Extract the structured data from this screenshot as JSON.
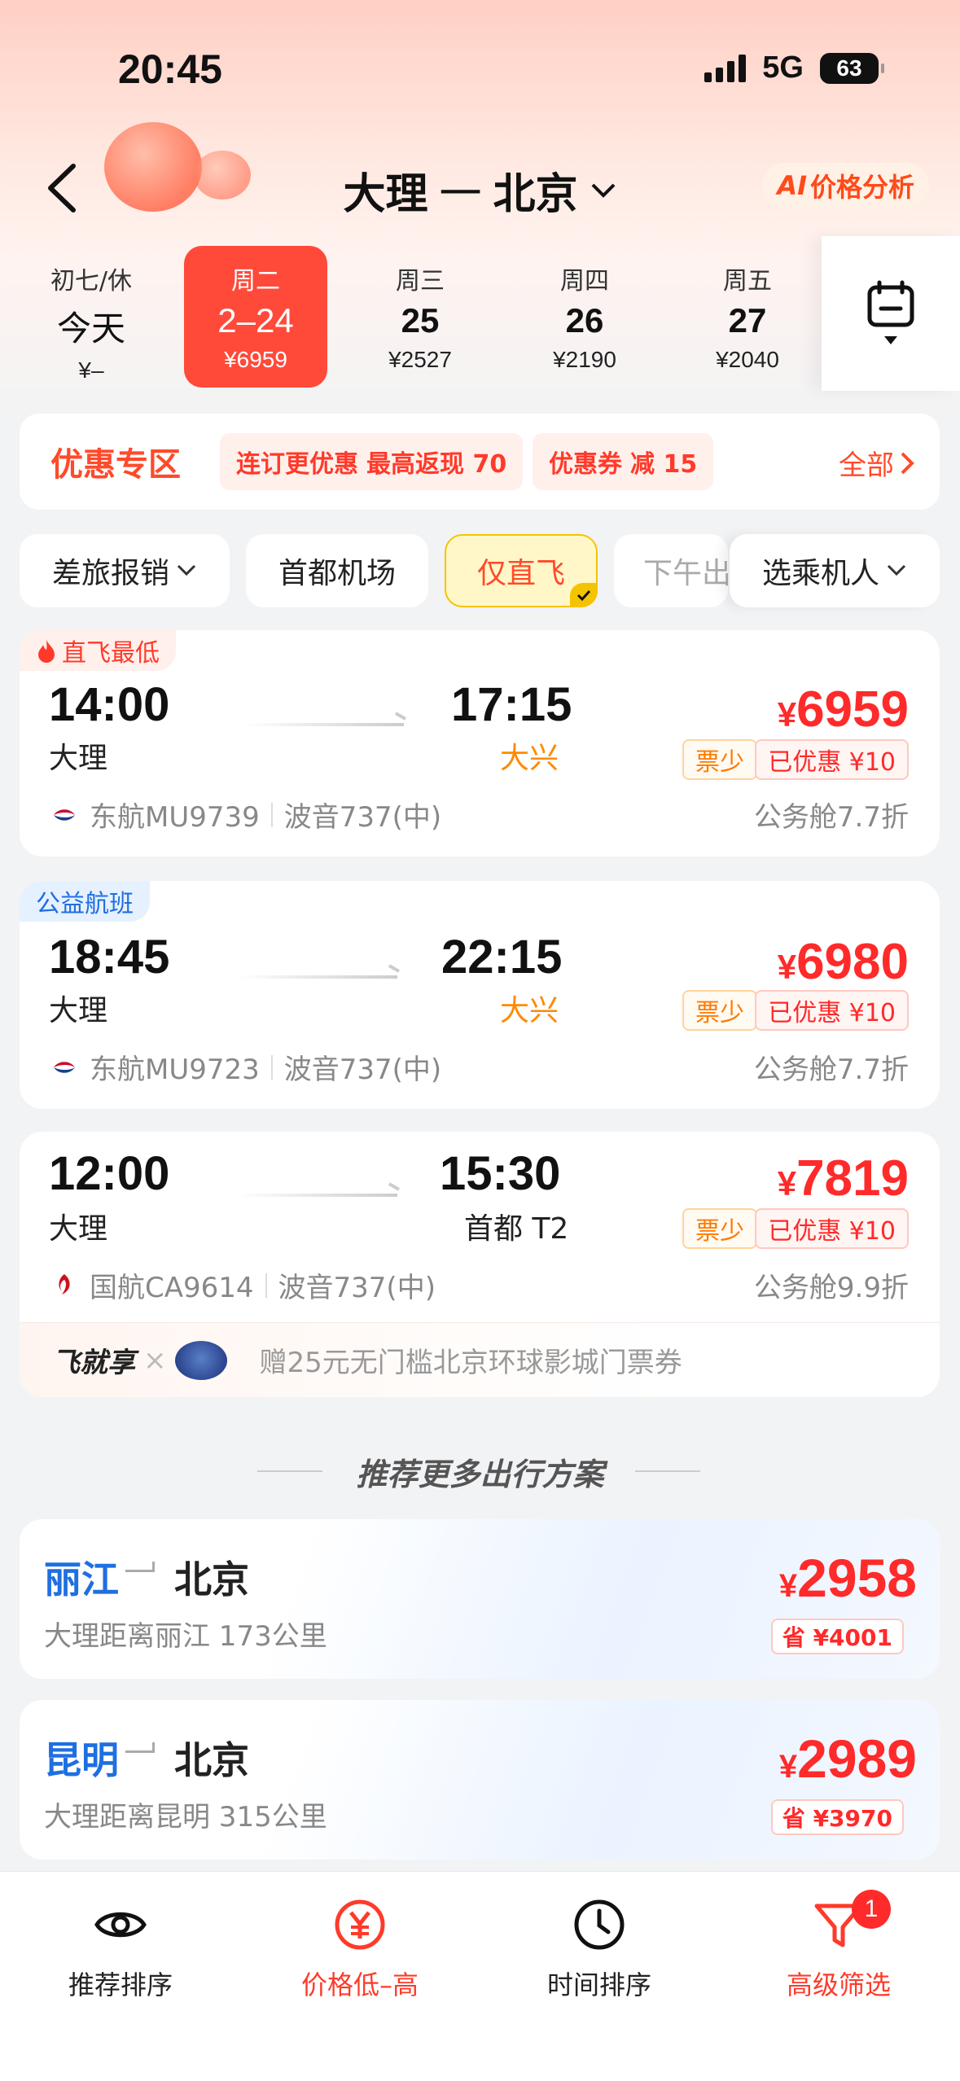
{
  "status_bar": {
    "time": "20:45",
    "network": "5G",
    "battery": "63"
  },
  "header": {
    "from": "大理",
    "separator": "一",
    "to": "北京",
    "ai_button": "价格分析",
    "ai_prefix": "AI"
  },
  "dates": [
    {
      "weekday": "初七/休",
      "date": "今天",
      "price": "¥–"
    },
    {
      "weekday": "周二",
      "date": "2–24",
      "price": "¥6959",
      "selected": true
    },
    {
      "weekday": "周三",
      "date": "25",
      "price": "¥2527"
    },
    {
      "weekday": "周四",
      "date": "26",
      "price": "¥2190"
    },
    {
      "weekday": "周五",
      "date": "27",
      "price": "¥2040"
    }
  ],
  "promo": {
    "title": "优惠专区",
    "chips": [
      {
        "a": "连订更优惠",
        "b": "最高返现 70"
      },
      {
        "a": "优惠券",
        "b": "减 15"
      }
    ],
    "all": "全部"
  },
  "filters": [
    {
      "label": "差旅报销"
    },
    {
      "label": "首都机场"
    },
    {
      "label": "仅直飞",
      "active": true
    },
    {
      "label": "下午出"
    },
    {
      "label": "选乘机人"
    }
  ],
  "flights": [
    {
      "tag": "直飞最低",
      "dep_time": "14:00",
      "dep_place": "大理",
      "arr_time": "17:15",
      "arr_place": "大兴",
      "currency": "¥",
      "price": "6959",
      "badge_few": "票少",
      "badge_off": "已优惠 ¥10",
      "airline": "东航MU9739",
      "aircraft": "波音737(中)",
      "cabin": "公务舱7.7折"
    },
    {
      "tag": "公益航班",
      "dep_time": "18:45",
      "dep_place": "大理",
      "arr_time": "22:15",
      "arr_place": "大兴",
      "currency": "¥",
      "price": "6980",
      "badge_few": "票少",
      "badge_off": "已优惠 ¥10",
      "airline": "东航MU9723",
      "aircraft": "波音737(中)",
      "cabin": "公务舱7.7折"
    },
    {
      "dep_time": "12:00",
      "dep_place": "大理",
      "arr_time": "15:30",
      "arr_place": "首都 T2",
      "currency": "¥",
      "price": "7819",
      "badge_few": "票少",
      "badge_off": "已优惠 ¥10",
      "airline": "国航CA9614",
      "aircraft": "波音737(中)",
      "cabin": "公务舱9.9折",
      "perk_title": "飞就享",
      "perk_x": "×",
      "perk_text": "赠25元无门槛北京环球影城门票券"
    }
  ],
  "recommend": {
    "heading": "推荐更多出行方案",
    "items": [
      {
        "from": "丽江",
        "to": "北京",
        "desc": "大理距离丽江 173公里",
        "currency": "¥",
        "price": "2958",
        "save": "省 ¥4001"
      },
      {
        "from": "昆明",
        "to": "北京",
        "desc": "大理距离昆明 315公里",
        "currency": "¥",
        "price": "2989",
        "save": "省 ¥3970"
      }
    ]
  },
  "tabs": [
    {
      "label": "推荐排序",
      "icon": "eye-icon"
    },
    {
      "label": "价格低–高",
      "icon": "yen-icon",
      "active": true
    },
    {
      "label": "时间排序",
      "icon": "clock-icon"
    },
    {
      "label": "高级筛选",
      "icon": "filter-icon",
      "badge": "1"
    }
  ],
  "colors": {
    "accent": "#ff3a2a",
    "orange": "#ff8a00",
    "blue": "#1f6fe0",
    "yellow": "#f5c400"
  }
}
